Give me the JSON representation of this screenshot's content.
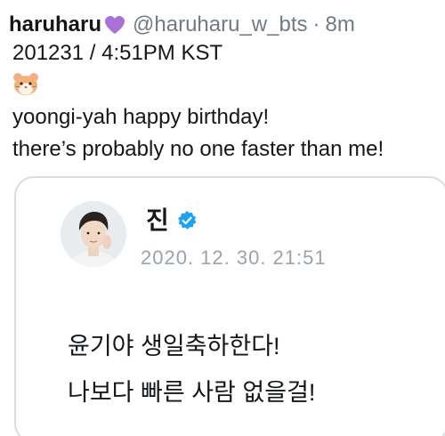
{
  "tweet": {
    "display_name": "haruharu",
    "heart_icon": "purple-heart-icon",
    "heart_color": "#a970d8",
    "handle": "@haruharu_w_bts",
    "separator": "·",
    "time": "8m",
    "lines": [
      "201231 / 4:51PM KST",
      "yoongi-yah happy birthday!",
      "there’s probably no one faster than me!"
    ],
    "emoji_icon": "hamster-face-emoji"
  },
  "quote": {
    "avatar_icon": "profile-photo",
    "name": "진",
    "verified_icon": "verified-badge-icon",
    "verified_color": "#1da1f2",
    "date": "2020. 12. 30. 21:51",
    "lines": [
      "윤기야 생일축하한다!",
      "나보다 빠른 사람 없을걸!"
    ]
  },
  "colors": {
    "text": "#14171a",
    "secondary": "#6f7a85",
    "border": "#d6dde3"
  }
}
